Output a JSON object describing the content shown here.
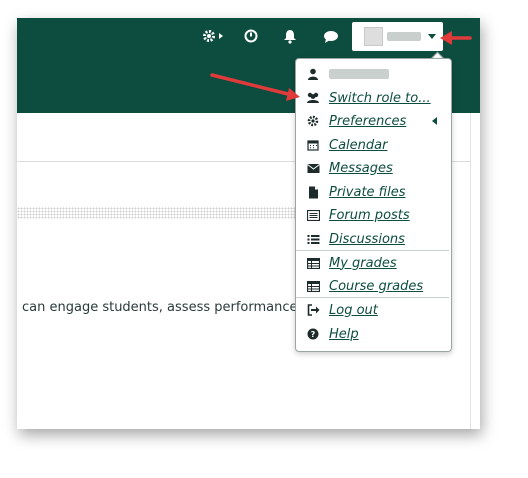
{
  "navbar": {
    "bg_color": "#0d4d3f",
    "icons": [
      "gear-icon",
      "history-icon",
      "bell-icon",
      "chat-icon",
      "chevron-down-icon"
    ]
  },
  "page": {
    "body_text": "can engage students, assess performance a"
  },
  "menu": {
    "items": [
      {
        "label": "Switch role to...",
        "icon": "users-icon"
      },
      {
        "label": "Preferences",
        "icon": "gear-icon"
      },
      {
        "label": "Calendar",
        "icon": "calendar-icon"
      },
      {
        "label": "Messages",
        "icon": "envelope-icon"
      },
      {
        "label": "Private files",
        "icon": "file-icon"
      },
      {
        "label": "Forum posts",
        "icon": "list-alt-icon"
      },
      {
        "label": "Discussions",
        "icon": "list-icon"
      },
      {
        "label": "My grades",
        "icon": "table-icon"
      },
      {
        "label": "Course grades",
        "icon": "table-icon"
      },
      {
        "label": "Log out",
        "icon": "sign-out-icon"
      },
      {
        "label": "Help",
        "icon": "question-circle-icon"
      }
    ]
  },
  "annotation": {
    "color": "#e03a3a"
  }
}
